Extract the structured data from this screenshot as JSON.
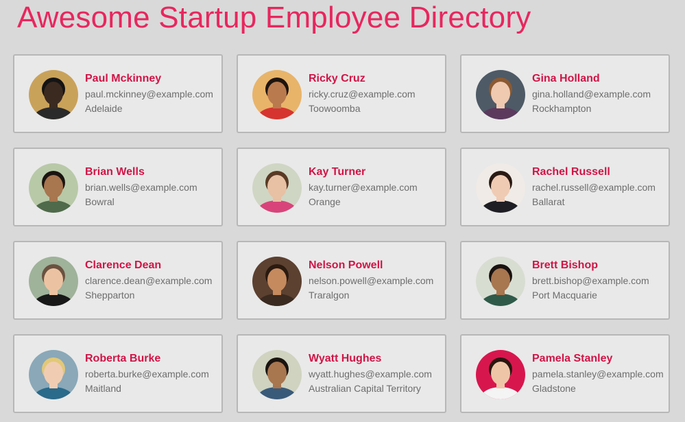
{
  "title": "Awesome Startup Employee Directory",
  "employees": [
    {
      "name": "Paul Mckinney",
      "email": "paul.mckinney@example.com",
      "city": "Adelaide",
      "bg": "#c9a25a",
      "skin": "#3b2a20",
      "hair": "#141414",
      "shirt": "#2a2a2a"
    },
    {
      "name": "Ricky Cruz",
      "email": "ricky.cruz@example.com",
      "city": "Toowoomba",
      "bg": "#e8b46a",
      "skin": "#b97a4e",
      "hair": "#1e140e",
      "shirt": "#d6342f"
    },
    {
      "name": "Gina Holland",
      "email": "gina.holland@example.com",
      "city": "Rockhampton",
      "bg": "#4e5a66",
      "skin": "#efc9b0",
      "hair": "#8a5a32",
      "shirt": "#5b3a5e"
    },
    {
      "name": "Brian Wells",
      "email": "brian.wells@example.com",
      "city": "Bowral",
      "bg": "#b8c9a8",
      "skin": "#a8764f",
      "hair": "#1a1410",
      "shirt": "#4f6a4a"
    },
    {
      "name": "Kay Turner",
      "email": "kay.turner@example.com",
      "city": "Orange",
      "bg": "#cfd6c4",
      "skin": "#e8c0a4",
      "hair": "#5a3a24",
      "shirt": "#d8447a"
    },
    {
      "name": "Rachel Russell",
      "email": "rachel.russell@example.com",
      "city": "Ballarat",
      "bg": "#f0ebe6",
      "skin": "#efcbb4",
      "hair": "#2a1a14",
      "shirt": "#1e1e24"
    },
    {
      "name": "Clarence Dean",
      "email": "clarence.dean@example.com",
      "city": "Shepparton",
      "bg": "#9fb29a",
      "skin": "#ecc3a2",
      "hair": "#6b5240",
      "shirt": "#181818"
    },
    {
      "name": "Nelson Powell",
      "email": "nelson.powell@example.com",
      "city": "Traralgon",
      "bg": "#5c4030",
      "skin": "#c58a5e",
      "hair": "#2a1a10",
      "shirt": "#3a2a20"
    },
    {
      "name": "Brett Bishop",
      "email": "brett.bishop@example.com",
      "city": "Port Macquarie",
      "bg": "#d8ddd2",
      "skin": "#a8764f",
      "hair": "#181210",
      "shirt": "#2f5a4a"
    },
    {
      "name": "Roberta Burke",
      "email": "roberta.burke@example.com",
      "city": "Maitland",
      "bg": "#8aa8b8",
      "skin": "#f0cdb2",
      "hair": "#e2c878",
      "shirt": "#2a6a8a"
    },
    {
      "name": "Wyatt Hughes",
      "email": "wyatt.hughes@example.com",
      "city": "Australian Capital Territory",
      "bg": "#cfd3c0",
      "skin": "#a8764f",
      "hair": "#1a1410",
      "shirt": "#3a5a7a"
    },
    {
      "name": "Pamela Stanley",
      "email": "pamela.stanley@example.com",
      "city": "Gladstone",
      "bg": "#d8164e",
      "skin": "#efc5a8",
      "hair": "#2a1610",
      "shirt": "#f4f4f4"
    }
  ]
}
